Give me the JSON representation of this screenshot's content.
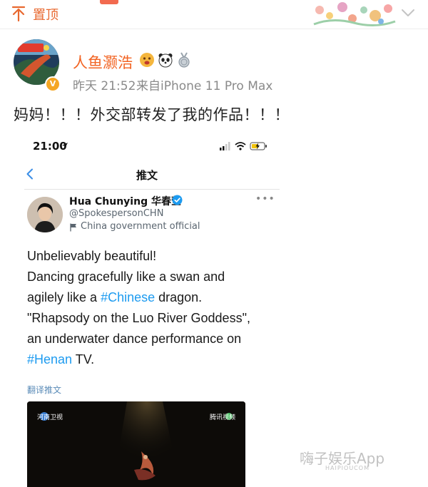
{
  "pinned": {
    "label": "置顶"
  },
  "post": {
    "author": {
      "name": "人鱼灏浩",
      "avatar_badge": "V"
    },
    "time": "昨天 21:52",
    "source": "来自iPhone 11 Pro Max",
    "text": "妈妈！！！外交部转发了我的作品！！！"
  },
  "embedded": {
    "status_time": "21:00",
    "nav_title": "推文",
    "tweet_author": {
      "name": "Hua Chunying 华春莹",
      "handle": "@SpokespersonCHN",
      "affiliation": "China government official"
    },
    "tweet_lines": [
      {
        "segments": [
          {
            "text": "Unbelievably beautiful!",
            "hashtag": false
          }
        ]
      },
      {
        "segments": [
          {
            "text": "Dancing gracefully like a swan and",
            "hashtag": false
          }
        ]
      },
      {
        "segments": [
          {
            "text": "agilely like a ",
            "hashtag": false
          },
          {
            "text": "#Chinese",
            "hashtag": true
          },
          {
            "text": " dragon.",
            "hashtag": false
          }
        ]
      },
      {
        "segments": [
          {
            "text": "\"Rhapsody on the Luo River Goddess\",",
            "hashtag": false
          }
        ]
      },
      {
        "segments": [
          {
            "text": "an underwater dance performance on",
            "hashtag": false
          }
        ]
      },
      {
        "segments": [
          {
            "text": "#Henan",
            "hashtag": true
          },
          {
            "text": " TV.",
            "hashtag": false
          }
        ]
      }
    ],
    "translate_label": "翻译推文",
    "video_logo_left": "河南卫视",
    "video_logo_right": "腾讯视频"
  },
  "watermark": {
    "text": "嗨子娱乐App",
    "sub": "HAIPIOUCOM"
  },
  "icons": [
    "pin-icon",
    "chevron-down-icon",
    "location-arrow-icon",
    "signal-icon",
    "wifi-icon",
    "battery-icon",
    "back-chevron-icon",
    "verified-icon",
    "more-icon",
    "flag-icon"
  ],
  "colors": {
    "accent_orange": "#f26322",
    "hashtag_blue": "#1d9bf0",
    "muted_gray": "#8a8a8a"
  }
}
